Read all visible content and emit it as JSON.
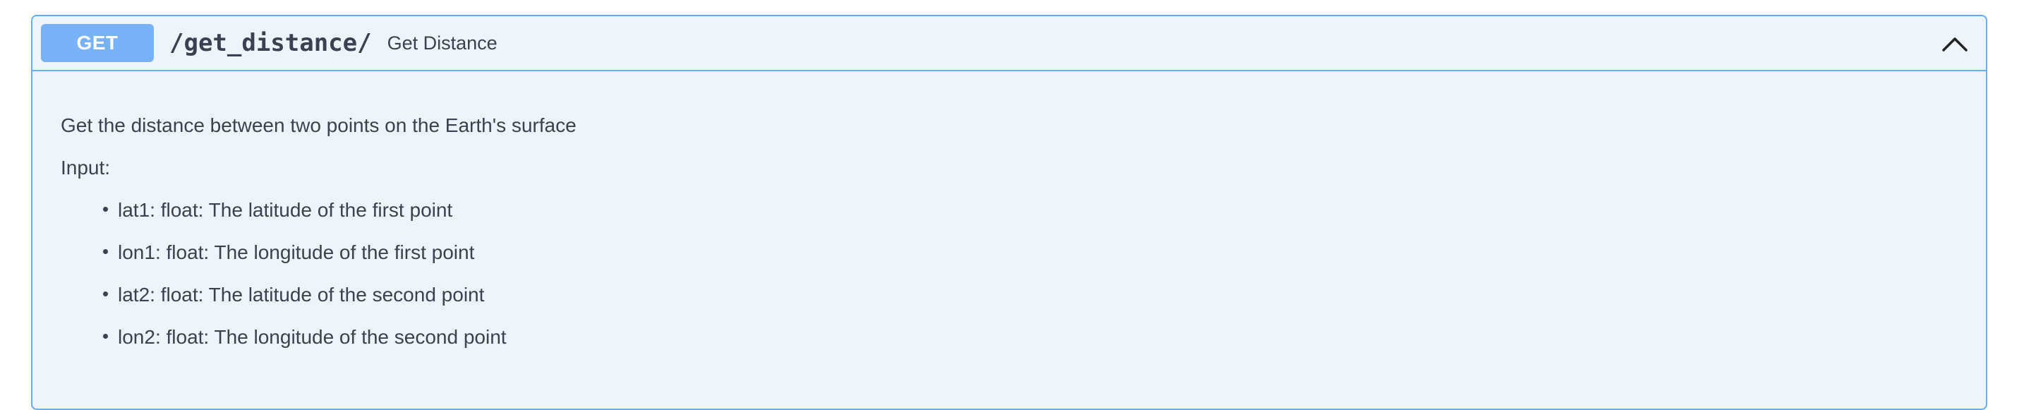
{
  "endpoint": {
    "method": "GET",
    "path": "/get_distance/",
    "summary": "Get Distance",
    "description": "Get the distance between two points on the Earth's surface",
    "input_label": "Input:",
    "params": [
      "lat1: float: The latitude of the first point",
      "lon1: float: The longitude of the first point",
      "lat2: float: The latitude of the second point",
      "lon2: float: The longitude of the second point"
    ],
    "collapse_icon": "chevron-up-icon"
  },
  "colors": {
    "border": "#61affe",
    "method_bg": "#78b2f6",
    "panel_bg": "#eef4fc",
    "text": "#3b4151"
  }
}
